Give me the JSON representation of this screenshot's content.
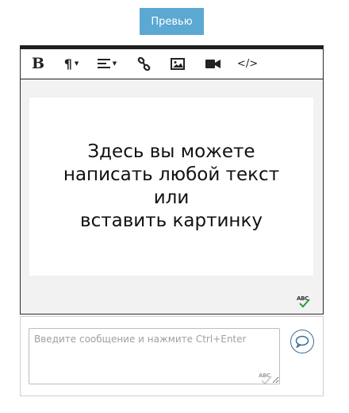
{
  "preview_button": {
    "label": "Превью"
  },
  "toolbar": {
    "bold_label": "B",
    "paragraph_label": "¶",
    "code_label": "</>"
  },
  "editor": {
    "content_text": "Здесь вы можете\nнаписать любой текст\nили\nвставить картинку",
    "spellcheck_label": "ABC"
  },
  "comment": {
    "placeholder": "Введите сообщение и нажмите Ctrl+Enter",
    "spellcheck_label": "ABC"
  },
  "colors": {
    "accent": "#5ba8d2",
    "send_icon": "#3c6e97",
    "spellcheck_check": "#2e9c3b"
  }
}
